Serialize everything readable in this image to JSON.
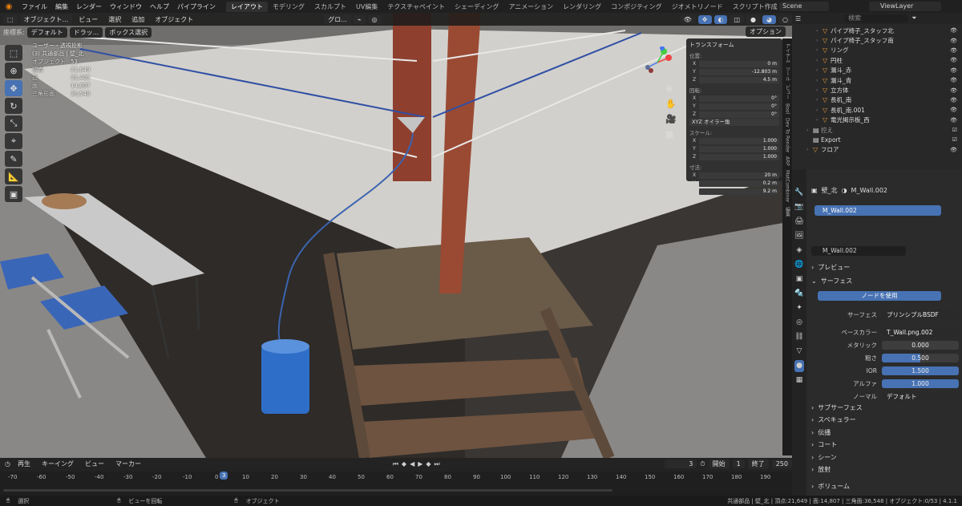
{
  "top_menu": [
    "ファイル",
    "編集",
    "レンダー",
    "ウィンドウ",
    "ヘルプ",
    "パイプライン"
  ],
  "workspace_tabs": [
    "レイアウト",
    "モデリング",
    "スカルプト",
    "UV編集",
    "テクスチャペイント",
    "シェーディング",
    "アニメーション",
    "レンダリング",
    "コンポジティング",
    "ジオメトリノード",
    "スクリプト作成"
  ],
  "active_workspace": "レイアウト",
  "scene_name": "Scene",
  "view_layer": "ViewLayer",
  "viewport_header": {
    "mode": "オブジェクト...",
    "menus": [
      "ビュー",
      "選択",
      "追加",
      "オブジェクト"
    ],
    "transform_orientation": "グロ...",
    "coord_label": "座標系:",
    "coord_value": "デフォルト",
    "drag_label": "ドラッ...",
    "select_mode": "ボックス選択",
    "options": "オプション"
  },
  "viewport_overlay": {
    "view_name": "ユーザー・透視投影",
    "collection": "(3) 共通部品 | 壁_北",
    "objects_label": "オブジェクト",
    "objects_value": "53",
    "vertices_label": "頂点",
    "vertices_value": "21,649",
    "edges_label": "辺",
    "edges_value": "35,405",
    "faces_label": "面",
    "faces_value": "14,807",
    "tris_label": "三角形面",
    "tris_value": "36,548"
  },
  "npanel": {
    "title": "トランスフォーム",
    "location_label": "位置:",
    "location": {
      "x": "0 m",
      "y": "-12.803 m",
      "z": "4.5 m"
    },
    "rotation_label": "回転:",
    "rotation": {
      "x": "0°",
      "y": "0°",
      "z": "0°"
    },
    "rotation_mode": "XYZ オイラー角",
    "scale_label": "スケール:",
    "scale": {
      "x": "1.000",
      "y": "1.000",
      "z": "1.000"
    },
    "dimensions_label": "寸法:",
    "dimensions": {
      "x": "20 m",
      "y": "0.2 m",
      "z": "9.2 m"
    },
    "tabs": [
      "アイテム",
      "ツール",
      "ビュー",
      "Bool",
      "Dev To Render",
      "ARP",
      "MatCombiner",
      "編集"
    ]
  },
  "outliner": {
    "search_placeholder": "検索",
    "items": [
      {
        "name": "パイプ椅子_スタッフ北",
        "collection": false
      },
      {
        "name": "パイプ椅子_スタッフ南",
        "collection": false
      },
      {
        "name": "リング",
        "collection": false
      },
      {
        "name": "円柱",
        "collection": false
      },
      {
        "name": "漏斗_赤",
        "collection": false
      },
      {
        "name": "漏斗_青",
        "collection": false
      },
      {
        "name": "立方体",
        "collection": false
      },
      {
        "name": "長机_南",
        "collection": false
      },
      {
        "name": "長机_南.001",
        "collection": false
      },
      {
        "name": "電光掲示板_西",
        "collection": false
      },
      {
        "name": "控え",
        "collection": true
      },
      {
        "name": "Export",
        "collection": true
      },
      {
        "name": "フロア",
        "collection": false
      }
    ]
  },
  "properties": {
    "object_name": "壁_北",
    "material_name": "M_Wall.002",
    "slot_name": "M_Wall.002",
    "preview": "プレビュー",
    "surface_section": "サーフェス",
    "use_nodes": "ノードを使用",
    "surface_label": "サーフェス",
    "surface_value": "プリンシプルBSDF",
    "base_color_label": "ベースカラー",
    "base_color_value": "T_Wall.png.002",
    "metallic_label": "メタリック",
    "metallic_value": "0.000",
    "roughness_label": "粗さ",
    "roughness_value": "0.500",
    "ior_label": "IOR",
    "ior_value": "1.500",
    "alpha_label": "アルファ",
    "alpha_value": "1.000",
    "normal_label": "ノーマル",
    "normal_value": "デフォルト",
    "sections": [
      "サブサーフェス",
      "スペキュラー",
      "伝播",
      "コート",
      "シーン",
      "放射",
      "ボリューム"
    ]
  },
  "timeline": {
    "menus": [
      "再生",
      "キーイング",
      "ビュー",
      "マーカー"
    ],
    "current_frame": "3",
    "start_label": "開始",
    "start": "1",
    "end_label": "終了",
    "end": "250",
    "ticks": [
      "-70",
      "-60",
      "-50",
      "-40",
      "-30",
      "-20",
      "-10",
      "0",
      "3",
      "10",
      "20",
      "30",
      "40",
      "50",
      "60",
      "70",
      "80",
      "90",
      "100",
      "110",
      "120",
      "130",
      "140",
      "150",
      "160",
      "170",
      "180",
      "190"
    ]
  },
  "statusbar": {
    "select": "選択",
    "rotate_view": "ビューを回転",
    "object": "オブジェクト",
    "stats": "共通部品 | 壁_北 | 頂点:21,649 | 面:14,807 | 三角面:36,548 | オブジェクト:0/53 | 4.1.1"
  },
  "colors": {
    "accent": "#4772b3",
    "bg": "#1d1d1d",
    "panel": "#2b2b2b",
    "orange": "#e87d0d"
  }
}
